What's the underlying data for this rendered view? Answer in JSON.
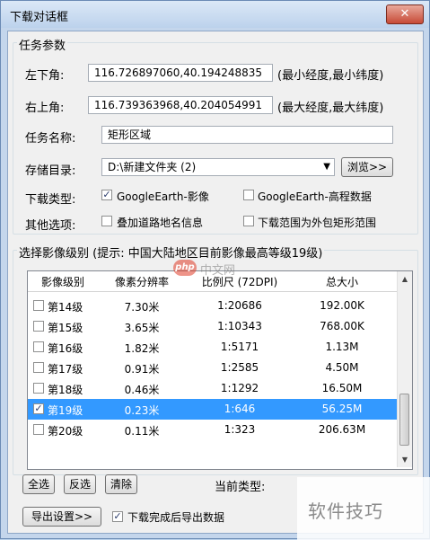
{
  "window": {
    "title": "下载对话框",
    "close_symbol": "✕"
  },
  "task_params": {
    "group_label": "任务参数",
    "lower_left_label": "左下角:",
    "lower_left_value": "116.726897060,40.194248835",
    "lower_left_hint": "(最小经度,最小纬度)",
    "upper_right_label": "右上角:",
    "upper_right_value": "116.739363968,40.204054991",
    "upper_right_hint": "(最大经度,最大纬度)",
    "task_name_label": "任务名称:",
    "task_name_value": "矩形区域",
    "storage_label": "存储目录:",
    "storage_value": "D:\\新建文件夹 (2)",
    "browse_label": "浏览>>",
    "download_type_label": "下载类型:",
    "type_ge_image": {
      "label": "GoogleEarth-影像",
      "checked": true
    },
    "type_ge_elevation": {
      "label": "GoogleEarth-高程数据",
      "checked": false
    },
    "other_options_label": "其他选项:",
    "opt_overlay_roads": {
      "label": "叠加道路地名信息",
      "checked": false
    },
    "opt_outer_rect": {
      "label": "下载范围为外包矩形范围",
      "checked": false
    }
  },
  "levels": {
    "group_label": "选择影像级别 (提示: 中国大陆地区目前影像最高等级19级)",
    "columns": [
      "影像级别",
      "像素分辨率",
      "比例尺 (72DPI)",
      "总大小"
    ],
    "rows": [
      {
        "level": "第14级",
        "resolution": "7.30米",
        "scale": "1:20686",
        "size": "192.00K",
        "checked": false,
        "selected": false
      },
      {
        "level": "第15级",
        "resolution": "3.65米",
        "scale": "1:10343",
        "size": "768.00K",
        "checked": false,
        "selected": false
      },
      {
        "level": "第16级",
        "resolution": "1.82米",
        "scale": "1:5171",
        "size": "1.13M",
        "checked": false,
        "selected": false
      },
      {
        "level": "第17级",
        "resolution": "0.91米",
        "scale": "1:2585",
        "size": "4.50M",
        "checked": false,
        "selected": false
      },
      {
        "level": "第18级",
        "resolution": "0.46米",
        "scale": "1:1292",
        "size": "16.50M",
        "checked": false,
        "selected": false
      },
      {
        "level": "第19级",
        "resolution": "0.23米",
        "scale": "1:646",
        "size": "56.25M",
        "checked": true,
        "selected": true
      },
      {
        "level": "第20级",
        "resolution": "0.11米",
        "scale": "1:323",
        "size": "206.63M",
        "checked": false,
        "selected": false
      }
    ],
    "select_all_label": "全选",
    "invert_label": "反选",
    "clear_label": "清除",
    "current_type_label": "当前类型:"
  },
  "footer": {
    "export_settings_label": "导出设置>>",
    "export_after_download": {
      "label": "下载完成后导出数据",
      "checked": true
    }
  },
  "watermarks": {
    "center_badge": "php",
    "center_text": "中文网",
    "corner_text": "软件技巧"
  }
}
